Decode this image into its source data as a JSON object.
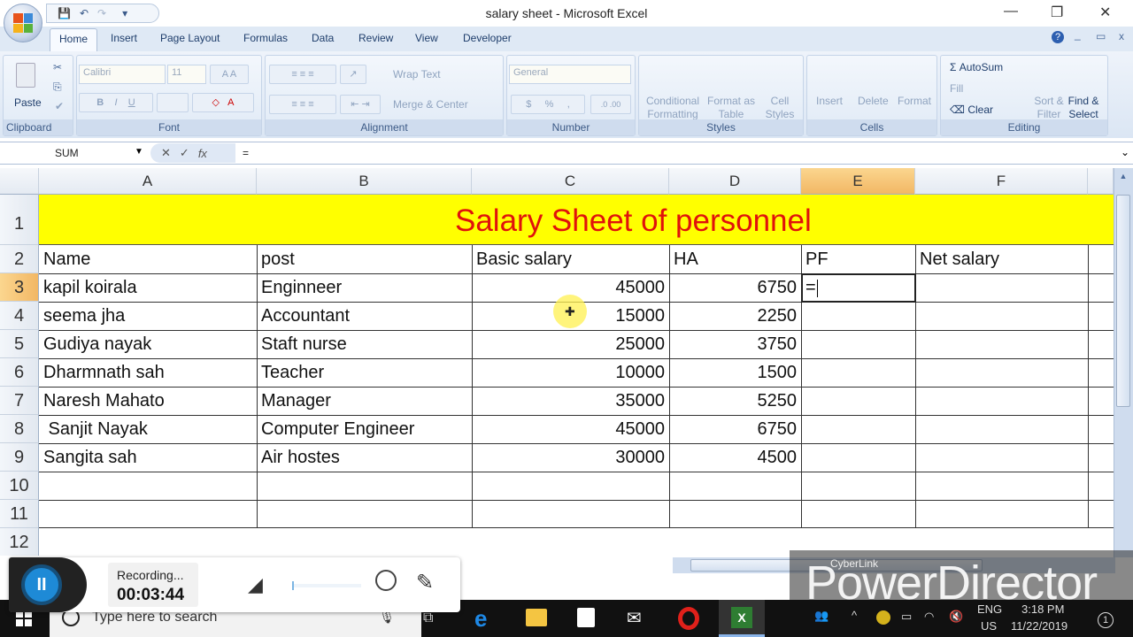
{
  "window": {
    "title": "salary sheet - Microsoft Excel",
    "minimize": "—",
    "restore": "❐",
    "close": "✕"
  },
  "quick_access": {
    "save_icon": "💾",
    "undo_icon": "↶",
    "redo_icon": "↷",
    "customize_icon": "▾"
  },
  "ribbon_tabs": [
    "Home",
    "Insert",
    "Page Layout",
    "Formulas",
    "Data",
    "Review",
    "View",
    "Developer"
  ],
  "ribbon_right": {
    "help": "?",
    "minimize": "_",
    "restore": "▭",
    "close": "x"
  },
  "ribbon": {
    "clipboard": {
      "label": "Clipboard",
      "paste": "Paste"
    },
    "font": {
      "label": "Font",
      "font_name": "Calibri",
      "font_size": "11",
      "bold": "B",
      "italic": "I",
      "underline": "U"
    },
    "alignment": {
      "label": "Alignment",
      "wrap_text": "Wrap Text",
      "merge_center": "Merge & Center"
    },
    "number": {
      "label": "Number",
      "format": "General",
      "currency": "$",
      "percent": "%",
      "comma": ","
    },
    "styles": {
      "label": "Styles",
      "conditional": "Conditional Formatting",
      "format_table": "Format as Table",
      "cell_styles": "Cell Styles"
    },
    "cells": {
      "label": "Cells",
      "insert": "Insert",
      "delete": "Delete",
      "format": "Format"
    },
    "editing": {
      "label": "Editing",
      "autosum": "AutoSum",
      "fill": "Fill",
      "clear": "Clear",
      "sort_filter": "Sort & Filter",
      "find_select": "Find & Select"
    }
  },
  "formula_bar": {
    "name_box": "SUM",
    "cancel": "✕",
    "enter": "✓",
    "fx": "fx",
    "formula": "="
  },
  "sheet": {
    "columns": [
      "A",
      "B",
      "C",
      "D",
      "E",
      "F"
    ],
    "selected_column": "E",
    "selected_row": "3",
    "row_numbers": [
      "1",
      "2",
      "3",
      "4",
      "5",
      "6",
      "7",
      "8",
      "9",
      "10",
      "11",
      "12"
    ],
    "title": "Salary Sheet of personnel",
    "headers": [
      "Name",
      "post",
      "Basic salary",
      "HA",
      "PF",
      "Net salary"
    ],
    "rows": [
      {
        "name": "kapil koirala",
        "post": "Enginneer",
        "basic": "45000",
        "ha": "6750",
        "pf": "=",
        "net": ""
      },
      {
        "name": "seema jha",
        "post": "Accountant",
        "basic": "15000",
        "ha": "2250",
        "pf": "",
        "net": ""
      },
      {
        "name": "Gudiya nayak",
        "post": "Staft nurse",
        "basic": "25000",
        "ha": "3750",
        "pf": "",
        "net": ""
      },
      {
        "name": "Dharmnath sah",
        "post": "Teacher",
        "basic": "10000",
        "ha": "1500",
        "pf": "",
        "net": ""
      },
      {
        "name": "Naresh Mahato",
        "post": "Manager",
        "basic": "35000",
        "ha": "5250",
        "pf": "",
        "net": ""
      },
      {
        "name": " Sanjit Nayak",
        "post": "Computer Engineer",
        "basic": "45000",
        "ha": "6750",
        "pf": "",
        "net": ""
      },
      {
        "name": "Sangita sah",
        "post": "Air hostes",
        "basic": "30000",
        "ha": "4500",
        "pf": "",
        "net": ""
      }
    ]
  },
  "recorder": {
    "status": "Recording...",
    "time": "00:03:44",
    "pause": "II"
  },
  "watermark": {
    "brand": "CyberLink",
    "product": "PowerDirector"
  },
  "taskbar": {
    "search_placeholder": "Type here to search",
    "lang": "ENG",
    "region": "US",
    "time": "3:18 PM",
    "date": "11/22/2019",
    "notifications": "1"
  },
  "colors": {
    "title_band": "#ffff00",
    "title_text": "#e0120c",
    "selection": "#f2b764",
    "ribbon": "#dfe9f5"
  }
}
